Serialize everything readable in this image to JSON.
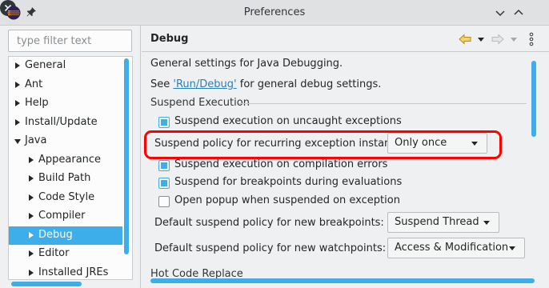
{
  "window": {
    "title": "Preferences"
  },
  "filter": {
    "placeholder": "type filter text",
    "value": ""
  },
  "tree": {
    "items": [
      {
        "label": "General",
        "expanded": false,
        "level": 0
      },
      {
        "label": "Ant",
        "expanded": false,
        "level": 0
      },
      {
        "label": "Help",
        "expanded": false,
        "level": 0
      },
      {
        "label": "Install/Update",
        "expanded": false,
        "level": 0
      },
      {
        "label": "Java",
        "expanded": true,
        "level": 0
      },
      {
        "label": "Appearance",
        "expanded": false,
        "level": 1
      },
      {
        "label": "Build Path",
        "expanded": false,
        "level": 1
      },
      {
        "label": "Code Style",
        "expanded": false,
        "level": 1
      },
      {
        "label": "Compiler",
        "expanded": false,
        "level": 1
      },
      {
        "label": "Debug",
        "expanded": false,
        "level": 1,
        "selected": true
      },
      {
        "label": "Editor",
        "expanded": false,
        "level": 1
      },
      {
        "label": "Installed JREs",
        "expanded": false,
        "level": 1
      }
    ]
  },
  "page": {
    "title": "Debug",
    "intro": "General settings for Java Debugging.",
    "see_prefix": "See ",
    "see_link": "'Run/Debug'",
    "see_suffix": " for general debug settings.",
    "group_suspend": "Suspend Execution",
    "cb_uncaught": "Suspend execution on uncaught exceptions",
    "recurring_label": "Suspend policy for recurring exception instances:",
    "recurring_value": "Only once",
    "cb_compilation": "Suspend execution on compilation errors",
    "cb_breakpoints_eval": "Suspend for breakpoints during evaluations",
    "cb_popup": "Open popup when suspended on exception",
    "bp_policy_label": "Default suspend policy for new breakpoints:",
    "bp_policy_value": "Suspend Thread",
    "wp_policy_label": "Default suspend policy for new watchpoints:",
    "wp_policy_value": "Access & Modification",
    "group_hcr": "Hot Code Replace"
  },
  "colors": {
    "accent": "#3daee9",
    "highlight": "#ff0000",
    "link": "#2980b9"
  }
}
